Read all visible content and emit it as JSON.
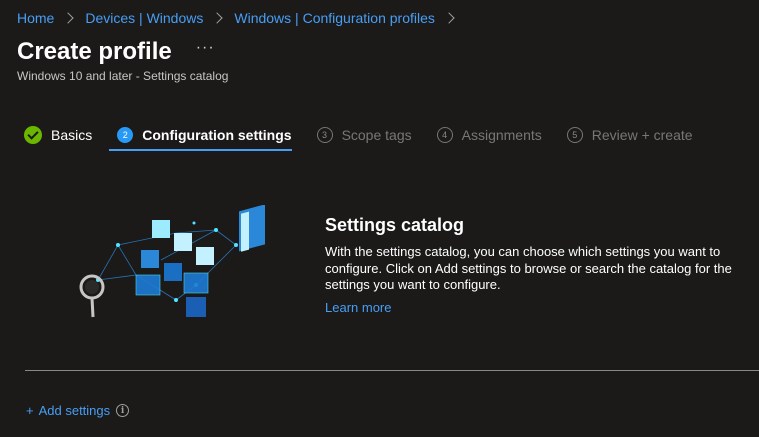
{
  "breadcrumb": {
    "items": [
      "Home",
      "Devices | Windows",
      "Windows | Configuration profiles"
    ]
  },
  "header": {
    "title": "Create profile",
    "more": "···",
    "subtitle": "Windows 10 and later - Settings catalog"
  },
  "steps": [
    {
      "number": "",
      "label": "Basics",
      "state": "done"
    },
    {
      "number": "2",
      "label": "Configuration settings",
      "state": "active"
    },
    {
      "number": "3",
      "label": "Scope tags",
      "state": "inactive"
    },
    {
      "number": "4",
      "label": "Assignments",
      "state": "inactive"
    },
    {
      "number": "5",
      "label": "Review + create",
      "state": "inactive"
    }
  ],
  "catalog": {
    "title": "Settings catalog",
    "description": "With the settings catalog, you can choose which settings you want to configure. Click on Add settings to browse or search the catalog for the settings you want to configure.",
    "learn_more": "Learn more"
  },
  "add_settings": {
    "plus": "+",
    "label": "Add settings",
    "info_icon": "i"
  },
  "colors": {
    "background": "#1b1a19",
    "link": "#479ef5",
    "success": "#6bb700",
    "active_step": "#2899f5"
  },
  "icons": {
    "check": "check-circle-icon",
    "more": "more-ellipsis-icon",
    "chevron": "chevron-right-icon",
    "info": "info-icon"
  }
}
